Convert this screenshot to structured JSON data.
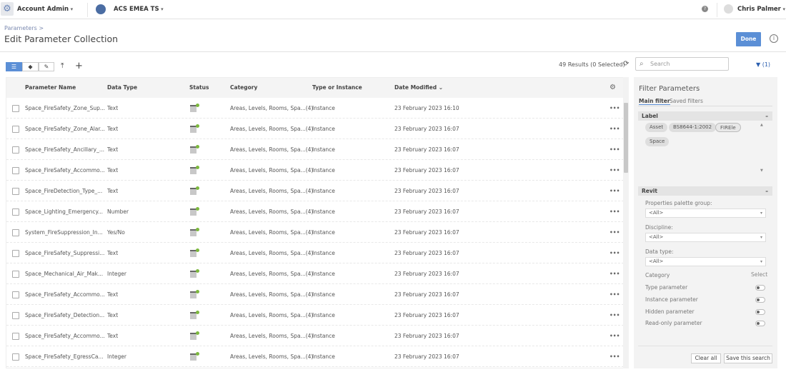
{
  "topbar": {
    "account": "Account Admin",
    "project": "ACS EMEA TS",
    "user": "Chris Palmer"
  },
  "header": {
    "breadcrumb": "Parameters >",
    "title": "Edit Parameter Collection",
    "done": "Done"
  },
  "toolbar": {
    "results": "49 Results (0 Selected)",
    "search_placeholder": "Search",
    "filter_count": "(1)"
  },
  "table": {
    "columns": [
      "Parameter Name",
      "Data Type",
      "Status",
      "Category",
      "Type or Instance",
      "Date Modified"
    ],
    "rows": [
      {
        "name": "Space_FireSafety_Zone_Sup...",
        "type": "Text",
        "category": "Areas, Levels, Rooms, Spa...(4)",
        "inst": "Instance",
        "date": "23 February 2023 16:10"
      },
      {
        "name": "Space_FireSafety_Zone_Alar...",
        "type": "Text",
        "category": "Areas, Levels, Rooms, Spa...(4)",
        "inst": "Instance",
        "date": "23 February 2023 16:07"
      },
      {
        "name": "Space_FireSafety_Ancillary_...",
        "type": "Text",
        "category": "Areas, Levels, Rooms, Spa...(4)",
        "inst": "Instance",
        "date": "23 February 2023 16:07"
      },
      {
        "name": "Space_FireSafety_Accommo...",
        "type": "Text",
        "category": "Areas, Levels, Rooms, Spa...(4)",
        "inst": "Instance",
        "date": "23 February 2023 16:07"
      },
      {
        "name": "Space_FireDetection_Type_...",
        "type": "Text",
        "category": "Areas, Levels, Rooms, Spa...(4)",
        "inst": "Instance",
        "date": "23 February 2023 16:07"
      },
      {
        "name": "Space_Lighting_Emergency...",
        "type": "Number",
        "category": "Areas, Levels, Rooms, Spa...(4)",
        "inst": "Instance",
        "date": "23 February 2023 16:07"
      },
      {
        "name": "System_FireSuppression_In...",
        "type": "Yes/No",
        "category": "Areas, Levels, Rooms, Spa...(4)",
        "inst": "Instance",
        "date": "23 February 2023 16:07"
      },
      {
        "name": "Space_FireSafety_Suppressi...",
        "type": "Text",
        "category": "Areas, Levels, Rooms, Spa...(4)",
        "inst": "Instance",
        "date": "23 February 2023 16:07"
      },
      {
        "name": "Space_Mechanical_Air_Mak...",
        "type": "Integer",
        "category": "Areas, Levels, Rooms, Spa...(4)",
        "inst": "Instance",
        "date": "23 February 2023 16:07"
      },
      {
        "name": "Space_FireSafety_Accommo...",
        "type": "Text",
        "category": "Areas, Levels, Rooms, Spa...(4)",
        "inst": "Instance",
        "date": "23 February 2023 16:07"
      },
      {
        "name": "Space_FireSafety_Detection...",
        "type": "Text",
        "category": "Areas, Levels, Rooms, Spa...(4)",
        "inst": "Instance",
        "date": "23 February 2023 16:07"
      },
      {
        "name": "Space_FireSafety_Accommo...",
        "type": "Text",
        "category": "Areas, Levels, Rooms, Spa...(4)",
        "inst": "Instance",
        "date": "23 February 2023 16:07"
      },
      {
        "name": "Space_FireSafety_EgressCa...",
        "type": "Integer",
        "category": "Areas, Levels, Rooms, Spa...(4)",
        "inst": "Instance",
        "date": "23 February 2023 16:07"
      }
    ]
  },
  "filter": {
    "title": "Filter Parameters",
    "tabs": [
      "Main filter",
      "Saved filters"
    ],
    "label_section": "Label",
    "chips": [
      "Asset",
      "BS8644-1:2002",
      "FIREle",
      "Space"
    ],
    "revit_section": "Revit",
    "ppg_label": "Properties palette group:",
    "ppg_value": "<All>",
    "disc_label": "Discipline:",
    "disc_value": "<All>",
    "dt_label": "Data type:",
    "dt_value": "<All>",
    "category_label": "Category",
    "select": "Select",
    "toggles": [
      "Type parameter",
      "Instance parameter",
      "Hidden parameter",
      "Read-only parameter"
    ],
    "clear": "Clear all",
    "save": "Save this search"
  }
}
